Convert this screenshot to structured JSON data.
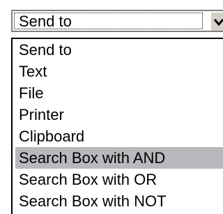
{
  "combo": {
    "selected_value": "Send to",
    "button_icon": "chevron-down-icon"
  },
  "list": {
    "selected_index": 5,
    "highlight_color": "#b8b8bd",
    "items": [
      {
        "label": "Send to"
      },
      {
        "label": "Text"
      },
      {
        "label": "File"
      },
      {
        "label": "Printer"
      },
      {
        "label": "Clipboard"
      },
      {
        "label": "Search Box with AND"
      },
      {
        "label": "Search Box with OR"
      },
      {
        "label": "Search Box with NOT"
      }
    ]
  }
}
